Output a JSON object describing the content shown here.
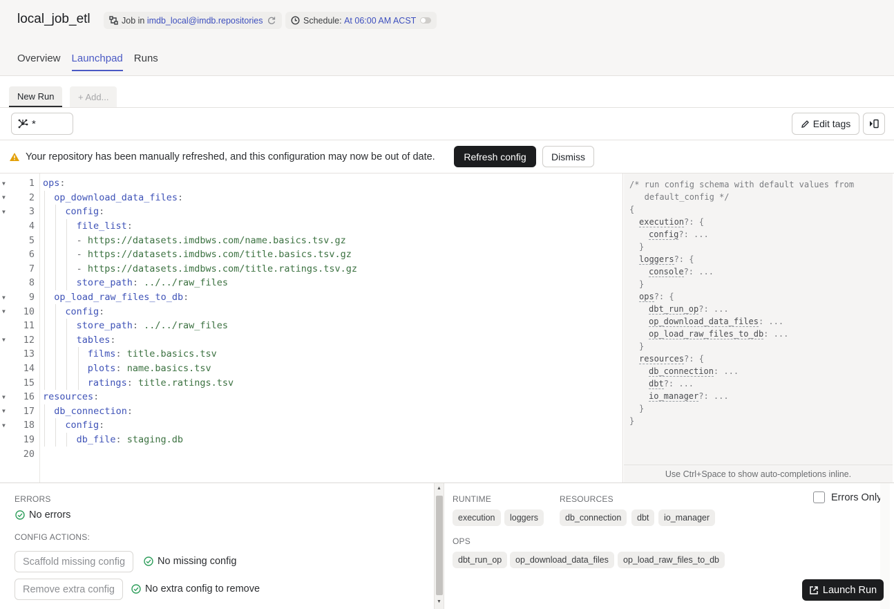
{
  "header": {
    "job_title": "local_job_etl",
    "job_prefix": "Job in ",
    "repository": "imdb_local@imdb.repositories",
    "schedule_prefix": "Schedule: ",
    "schedule": "At 06:00 AM ACST",
    "tabs": [
      {
        "label": "Overview",
        "active": false
      },
      {
        "label": "Launchpad",
        "active": true
      },
      {
        "label": "Runs",
        "active": false
      }
    ]
  },
  "sessions": {
    "active_tab": "New Run",
    "add_tab": "+ Add..."
  },
  "toolbar": {
    "op_selector_value": "*",
    "edit_tags_label": "Edit tags"
  },
  "warning": {
    "message": "Your repository has been manually refreshed, and this configuration may now be out of date.",
    "refresh_label": "Refresh config",
    "dismiss_label": "Dismiss"
  },
  "editor": {
    "lines": [
      {
        "n": "1",
        "key": "ops",
        "sep": ":",
        "val": "",
        "prefix": "",
        "fold": true,
        "indent": 0
      },
      {
        "n": "2",
        "key": "op_download_data_files",
        "sep": ":",
        "val": "",
        "prefix": "",
        "fold": true,
        "indent": 1
      },
      {
        "n": "3",
        "key": "config",
        "sep": ":",
        "val": "",
        "prefix": "",
        "fold": true,
        "indent": 2
      },
      {
        "n": "4",
        "key": "file_list",
        "sep": ":",
        "val": "",
        "prefix": "",
        "fold": false,
        "indent": 3
      },
      {
        "n": "5",
        "key": "",
        "sep": "",
        "val": "https://datasets.imdbws.com/name.basics.tsv.gz",
        "prefix": "- ",
        "fold": false,
        "indent": 3
      },
      {
        "n": "6",
        "key": "",
        "sep": "",
        "val": "https://datasets.imdbws.com/title.basics.tsv.gz",
        "prefix": "- ",
        "fold": false,
        "indent": 3
      },
      {
        "n": "7",
        "key": "",
        "sep": "",
        "val": "https://datasets.imdbws.com/title.ratings.tsv.gz",
        "prefix": "- ",
        "fold": false,
        "indent": 3
      },
      {
        "n": "8",
        "key": "store_path",
        "sep": ": ",
        "val": "../../raw_files",
        "prefix": "",
        "fold": false,
        "indent": 3
      },
      {
        "n": "9",
        "key": "op_load_raw_files_to_db",
        "sep": ":",
        "val": "",
        "prefix": "",
        "fold": true,
        "indent": 1
      },
      {
        "n": "10",
        "key": "config",
        "sep": ":",
        "val": "",
        "prefix": "",
        "fold": true,
        "indent": 2
      },
      {
        "n": "11",
        "key": "store_path",
        "sep": ": ",
        "val": "../../raw_files",
        "prefix": "",
        "fold": false,
        "indent": 3
      },
      {
        "n": "12",
        "key": "tables",
        "sep": ":",
        "val": "",
        "prefix": "",
        "fold": true,
        "indent": 3
      },
      {
        "n": "13",
        "key": "films",
        "sep": ": ",
        "val": "title.basics.tsv",
        "prefix": "",
        "fold": false,
        "indent": 4
      },
      {
        "n": "14",
        "key": "plots",
        "sep": ": ",
        "val": "name.basics.tsv",
        "prefix": "",
        "fold": false,
        "indent": 4
      },
      {
        "n": "15",
        "key": "ratings",
        "sep": ": ",
        "val": "title.ratings.tsv",
        "prefix": "",
        "fold": false,
        "indent": 4
      },
      {
        "n": "16",
        "key": "resources",
        "sep": ":",
        "val": "",
        "prefix": "",
        "fold": true,
        "indent": 0
      },
      {
        "n": "17",
        "key": "db_connection",
        "sep": ":",
        "val": "",
        "prefix": "",
        "fold": true,
        "indent": 1
      },
      {
        "n": "18",
        "key": "config",
        "sep": ":",
        "val": "",
        "prefix": "",
        "fold": true,
        "indent": 2
      },
      {
        "n": "19",
        "key": "db_file",
        "sep": ": ",
        "val": "staging.db",
        "prefix": "",
        "fold": false,
        "indent": 3
      },
      {
        "n": "20",
        "key": "",
        "sep": "",
        "val": "",
        "prefix": "",
        "fold": false,
        "indent": 0
      }
    ]
  },
  "schema": {
    "comment_1": "/* run config schema with default values from",
    "comment_2": "   default_config */",
    "lines": [
      {
        "text": "{",
        "key": "",
        "rest": "",
        "indent": 0
      },
      {
        "text": "",
        "key": "execution",
        "rest": "?: {",
        "indent": 1
      },
      {
        "text": "",
        "key": "config",
        "rest": "?: ...",
        "indent": 2
      },
      {
        "text": "}",
        "key": "",
        "rest": "",
        "indent": 1
      },
      {
        "text": "",
        "key": "loggers",
        "rest": "?: {",
        "indent": 1
      },
      {
        "text": "",
        "key": "console",
        "rest": "?: ...",
        "indent": 2
      },
      {
        "text": "}",
        "key": "",
        "rest": "",
        "indent": 1
      },
      {
        "text": "",
        "key": "ops",
        "rest": "?: {",
        "indent": 1
      },
      {
        "text": "",
        "key": "dbt_run_op",
        "rest": "?: ...",
        "indent": 2
      },
      {
        "text": "",
        "key": "op_download_data_files",
        "rest": ": ...",
        "indent": 2
      },
      {
        "text": "",
        "key": "op_load_raw_files_to_db",
        "rest": ": ...",
        "indent": 2
      },
      {
        "text": "}",
        "key": "",
        "rest": "",
        "indent": 1
      },
      {
        "text": "",
        "key": "resources",
        "rest": "?: {",
        "indent": 1
      },
      {
        "text": "",
        "key": "db_connection",
        "rest": ": ...",
        "indent": 2
      },
      {
        "text": "",
        "key": "dbt",
        "rest": "?: ...",
        "indent": 2
      },
      {
        "text": "",
        "key": "io_manager",
        "rest": "?: ...",
        "indent": 2
      },
      {
        "text": "}",
        "key": "",
        "rest": "",
        "indent": 1
      },
      {
        "text": "}",
        "key": "",
        "rest": "",
        "indent": 0
      }
    ],
    "footer": "Use Ctrl+Space to show auto-completions inline."
  },
  "bottom": {
    "errors_label": "ERRORS",
    "no_errors": "No errors",
    "config_actions_label": "CONFIG ACTIONS:",
    "scaffold_label": "Scaffold missing config",
    "no_missing": "No missing config",
    "remove_label": "Remove extra config",
    "no_extra": "No extra config to remove",
    "runtime_label": "RUNTIME",
    "runtime_items": [
      "execution",
      "loggers"
    ],
    "resources_label": "RESOURCES",
    "resource_items": [
      "db_connection",
      "dbt",
      "io_manager"
    ],
    "ops_label": "OPS",
    "op_items": [
      "dbt_run_op",
      "op_download_data_files",
      "op_load_raw_files_to_db"
    ],
    "errors_only_label": "Errors Only",
    "launch_label": "Launch Run"
  },
  "colors": {
    "accent": "#4a59c4",
    "success": "#2e9e5b",
    "warning": "#e3a008",
    "primary_button": "#1c1d1f"
  }
}
